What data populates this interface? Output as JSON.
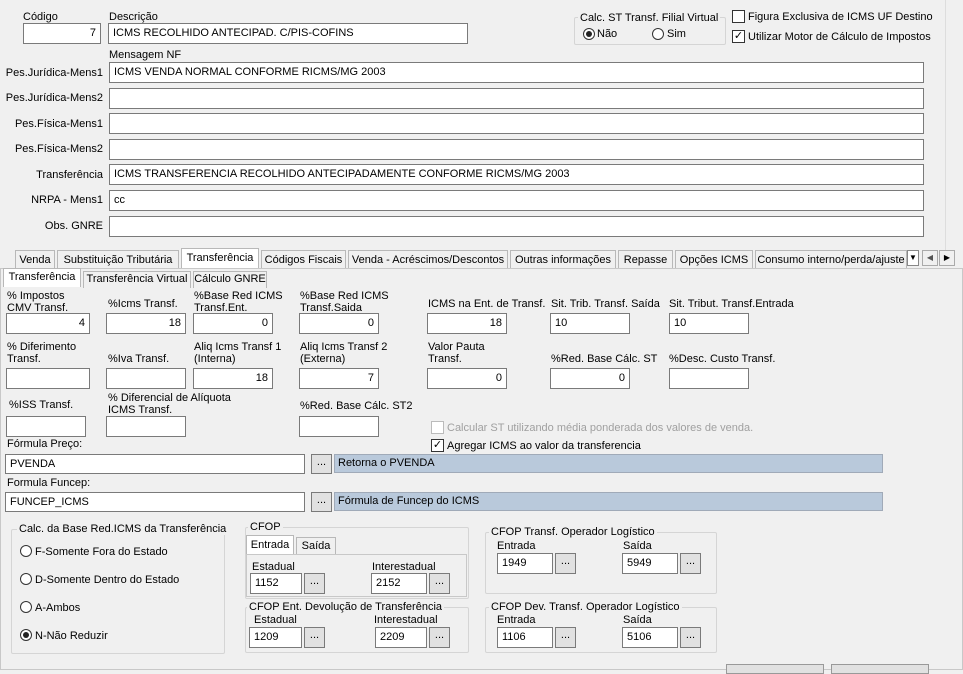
{
  "header": {
    "codigo_label": "Código",
    "codigo_value": "7",
    "descricao_label": "Descrição",
    "descricao_value": "ICMS RECOLHIDO ANTECIPAD. C/PIS-COFINS",
    "mensagem_nf_label": "Mensagem NF",
    "calc_st_title": "Calc. ST Transf. Filial Virtual",
    "calc_st_nao": "Não",
    "calc_st_sim": "Sim",
    "figura_exclusiva_label": "Figura Exclusiva de ICMS UF Destino",
    "utilizar_motor_label": "Utilizar Motor de Cálculo de Impostos"
  },
  "messages": [
    {
      "label": "Pes.Jurídica-Mens1",
      "value": "ICMS  VENDA NORMAL  CONFORME RICMS/MG 2003"
    },
    {
      "label": "Pes.Jurídica-Mens2",
      "value": ""
    },
    {
      "label": "Pes.Física-Mens1",
      "value": ""
    },
    {
      "label": "Pes.Física-Mens2",
      "value": ""
    },
    {
      "label": "Transferência",
      "value": "ICMS  TRANSFERENCIA  RECOLHIDO ANTECIPADAMENTE CONFORME RICMS/MG 2003"
    },
    {
      "label": "NRPA - Mens1",
      "value": "cc"
    },
    {
      "label": "Obs. GNRE",
      "value": ""
    }
  ],
  "main_tabs": [
    "Venda",
    "Substituição Tributária",
    "Transferência",
    "Códigos Fiscais",
    "Venda - Acréscimos/Descontos",
    "Outras informações",
    "Repasse",
    "Opções ICMS",
    "Consumo interno/perda/ajuste"
  ],
  "sub_tabs": [
    "Transferência",
    "Transferência Virtual",
    "Cálculo GNRE"
  ],
  "fields": {
    "impostos_cmv": {
      "label": "% Impostos\nCMV Transf.",
      "value": "4"
    },
    "icms_transf": {
      "label": "%Icms Transf.",
      "value": "18"
    },
    "base_red_ent": {
      "label": "%Base Red ICMS\nTransf.Ent.",
      "value": "0"
    },
    "base_red_saida": {
      "label": "%Base Red ICMS\nTransf.Saida",
      "value": "0"
    },
    "icms_ent": {
      "label": "ICMS na Ent. de Transf.",
      "value": "18"
    },
    "sit_trib_saida": {
      "label": "Sit. Trib. Transf. Saída",
      "value": "10"
    },
    "sit_trib_entrada": {
      "label": "Sit. Tribut. Transf.Entrada",
      "value": "10"
    },
    "diferimento": {
      "label": "% Diferimento\nTransf.",
      "value": ""
    },
    "iva_transf": {
      "label": "%Iva Transf.",
      "value": ""
    },
    "aliq_interna": {
      "label": "Aliq Icms Transf 1\n(Interna)",
      "value": "18"
    },
    "aliq_externa": {
      "label": "Aliq Icms Transf 2\n(Externa)",
      "value": "7"
    },
    "valor_pauta": {
      "label": "Valor Pauta\nTransf.",
      "value": "0"
    },
    "red_base_st": {
      "label": "%Red. Base Cálc. ST",
      "value": "0"
    },
    "desc_custo": {
      "label": "%Desc. Custo Transf.",
      "value": ""
    },
    "iss_transf": {
      "label": "%ISS  Transf.",
      "value": ""
    },
    "dif_aliquota": {
      "label": "% Diferencial de Alíquota\nICMS Transf.",
      "value": ""
    },
    "red_base_st2": {
      "label": "%Red. Base Cálc. ST2",
      "value": ""
    }
  },
  "checks": {
    "calc_st_media": "Calcular ST utilizando média ponderada dos valores de venda.",
    "agregar_icms": "Agregar ICMS ao valor da transferencia"
  },
  "formula_preco": {
    "label": "Fórmula Preço:",
    "value": "PVENDA",
    "desc": "Retorna o PVENDA",
    "btn": "..."
  },
  "formula_funcep": {
    "label": "Formula Funcep:",
    "value": "FUNCEP_ICMS",
    "desc": "Fórmula de Funcep do ICMS",
    "btn": "..."
  },
  "base_red_group": {
    "title": "Calc. da Base Red.ICMS da Transferência",
    "options": [
      "F-Somente Fora do Estado",
      "D-Somente Dentro do Estado",
      "A-Ambos",
      "N-Não Reduzir"
    ]
  },
  "cfop": {
    "title": "CFOP",
    "tabs": [
      "Entrada",
      "Saída"
    ],
    "estadual_label": "Estadual",
    "estadual": "1152",
    "interestadual_label": "Interestadual",
    "interestadual": "2152"
  },
  "cfop_dev": {
    "title": "CFOP Ent. Devolução de Transferência",
    "estadual_label": "Estadual",
    "estadual": "1209",
    "interestadual_label": "Interestadual",
    "interestadual": "2209"
  },
  "cfop_op_log": {
    "title": "CFOP Transf. Operador Logístico",
    "entrada_label": "Entrada",
    "entrada": "1949",
    "saida_label": "Saída",
    "saida": "5949"
  },
  "cfop_dev_op_log": {
    "title": "CFOP Dev. Transf. Operador Logístico",
    "entrada_label": "Entrada",
    "entrada": "1106",
    "saida_label": "Saída",
    "saida": "5106"
  },
  "ellipsis": "...",
  "scroll_btns": {
    "down": "▼",
    "left": "◀",
    "right": "▶"
  }
}
